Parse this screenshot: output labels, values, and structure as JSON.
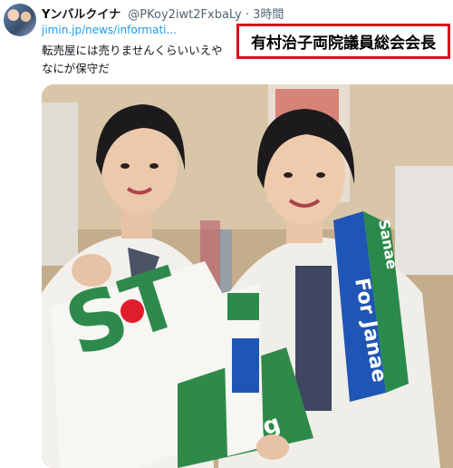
{
  "tweet": {
    "display_name": "Yンバルクイナ",
    "handle_time": "@PKoy2iwt2FxbaLy · 3時間",
    "link": "jimin.jp/news/informati...",
    "text_line1": "転売屋には売りませんくらいいえや",
    "text_line2": "なにが保守だ"
  },
  "overlay": {
    "caption": "有村治子両院議員総会会長"
  },
  "photo": {
    "towel_left_text": "ST",
    "towel_left_tail": "Fig",
    "towel_right_text_1": "For Janae",
    "towel_right_text_2": "Sanae"
  }
}
